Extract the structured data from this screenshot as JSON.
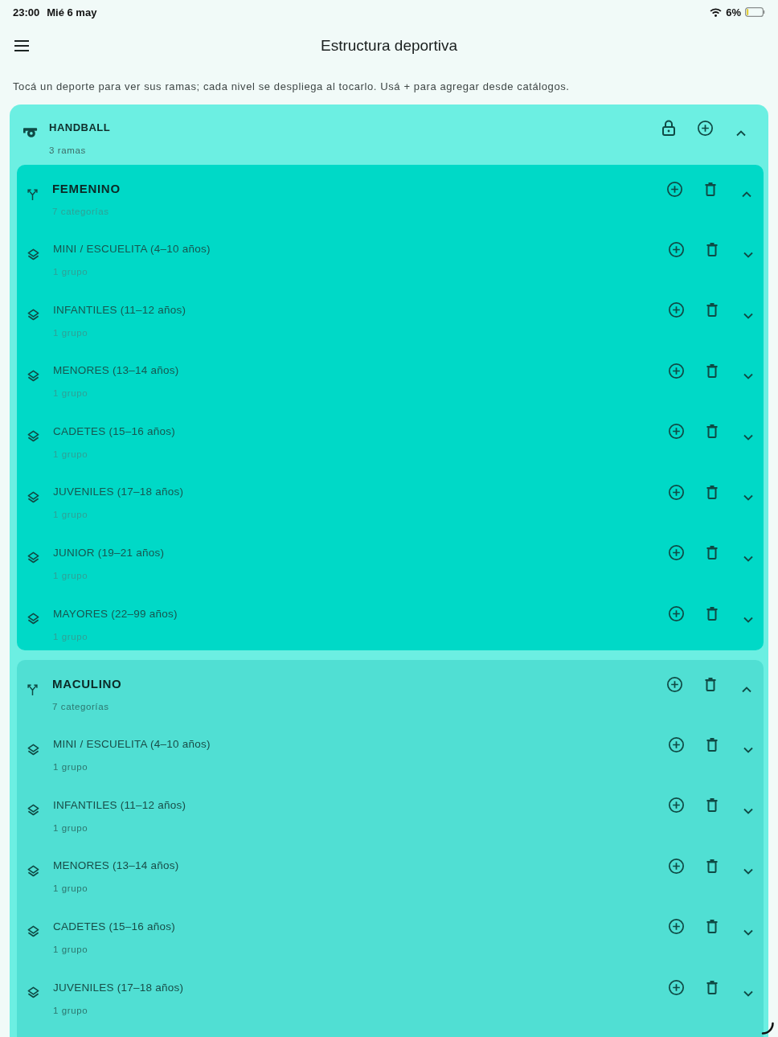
{
  "status_bar": {
    "time": "23:00",
    "date": "Mié 6 may",
    "battery": "6%"
  },
  "app_bar": {
    "title": "Estructura deportiva"
  },
  "hint": "Tocá un deporte para ver sus ramas; cada nivel se despliega al tocarlo. Usá + para agregar desde catálogos.",
  "sports": [
    {
      "name": "HANDBALL",
      "subtitle": "3 ramas",
      "locked": true,
      "expanded": true,
      "children": [
        {
          "name": "FEMENINO",
          "subtitle": "7 categorías",
          "selected": true,
          "expanded": true,
          "children": [
            {
              "name": "MINI / ESCUELITA (4–10 años)",
              "subtitle": "1 grupo",
              "expanded": false
            },
            {
              "name": "INFANTILES (11–12 años)",
              "subtitle": "1 grupo",
              "expanded": false
            },
            {
              "name": "MENORES (13–14 años)",
              "subtitle": "1 grupo",
              "expanded": false
            },
            {
              "name": "CADETES (15–16 años)",
              "subtitle": "1 grupo",
              "expanded": false
            },
            {
              "name": "JUVENILES (17–18 años)",
              "subtitle": "1 grupo",
              "expanded": false
            },
            {
              "name": "JUNIOR (19–21 años)",
              "subtitle": "1 grupo",
              "expanded": false
            },
            {
              "name": "MAYORES (22–99 años)",
              "subtitle": "1 grupo",
              "expanded": false
            }
          ]
        },
        {
          "name": "MACULINO",
          "subtitle": "7 categorías",
          "selected": false,
          "expanded": true,
          "children": [
            {
              "name": "MINI / ESCUELITA (4–10 años)",
              "subtitle": "1 grupo",
              "expanded": false
            },
            {
              "name": "INFANTILES (11–12 años)",
              "subtitle": "1 grupo",
              "expanded": false
            },
            {
              "name": "MENORES (13–14 años)",
              "subtitle": "1 grupo",
              "expanded": false
            },
            {
              "name": "CADETES (15–16 años)",
              "subtitle": "1 grupo",
              "expanded": false
            },
            {
              "name": "JUVENILES (17–18 años)",
              "subtitle": "1 grupo",
              "expanded": false
            }
          ]
        }
      ]
    }
  ],
  "loading": true
}
